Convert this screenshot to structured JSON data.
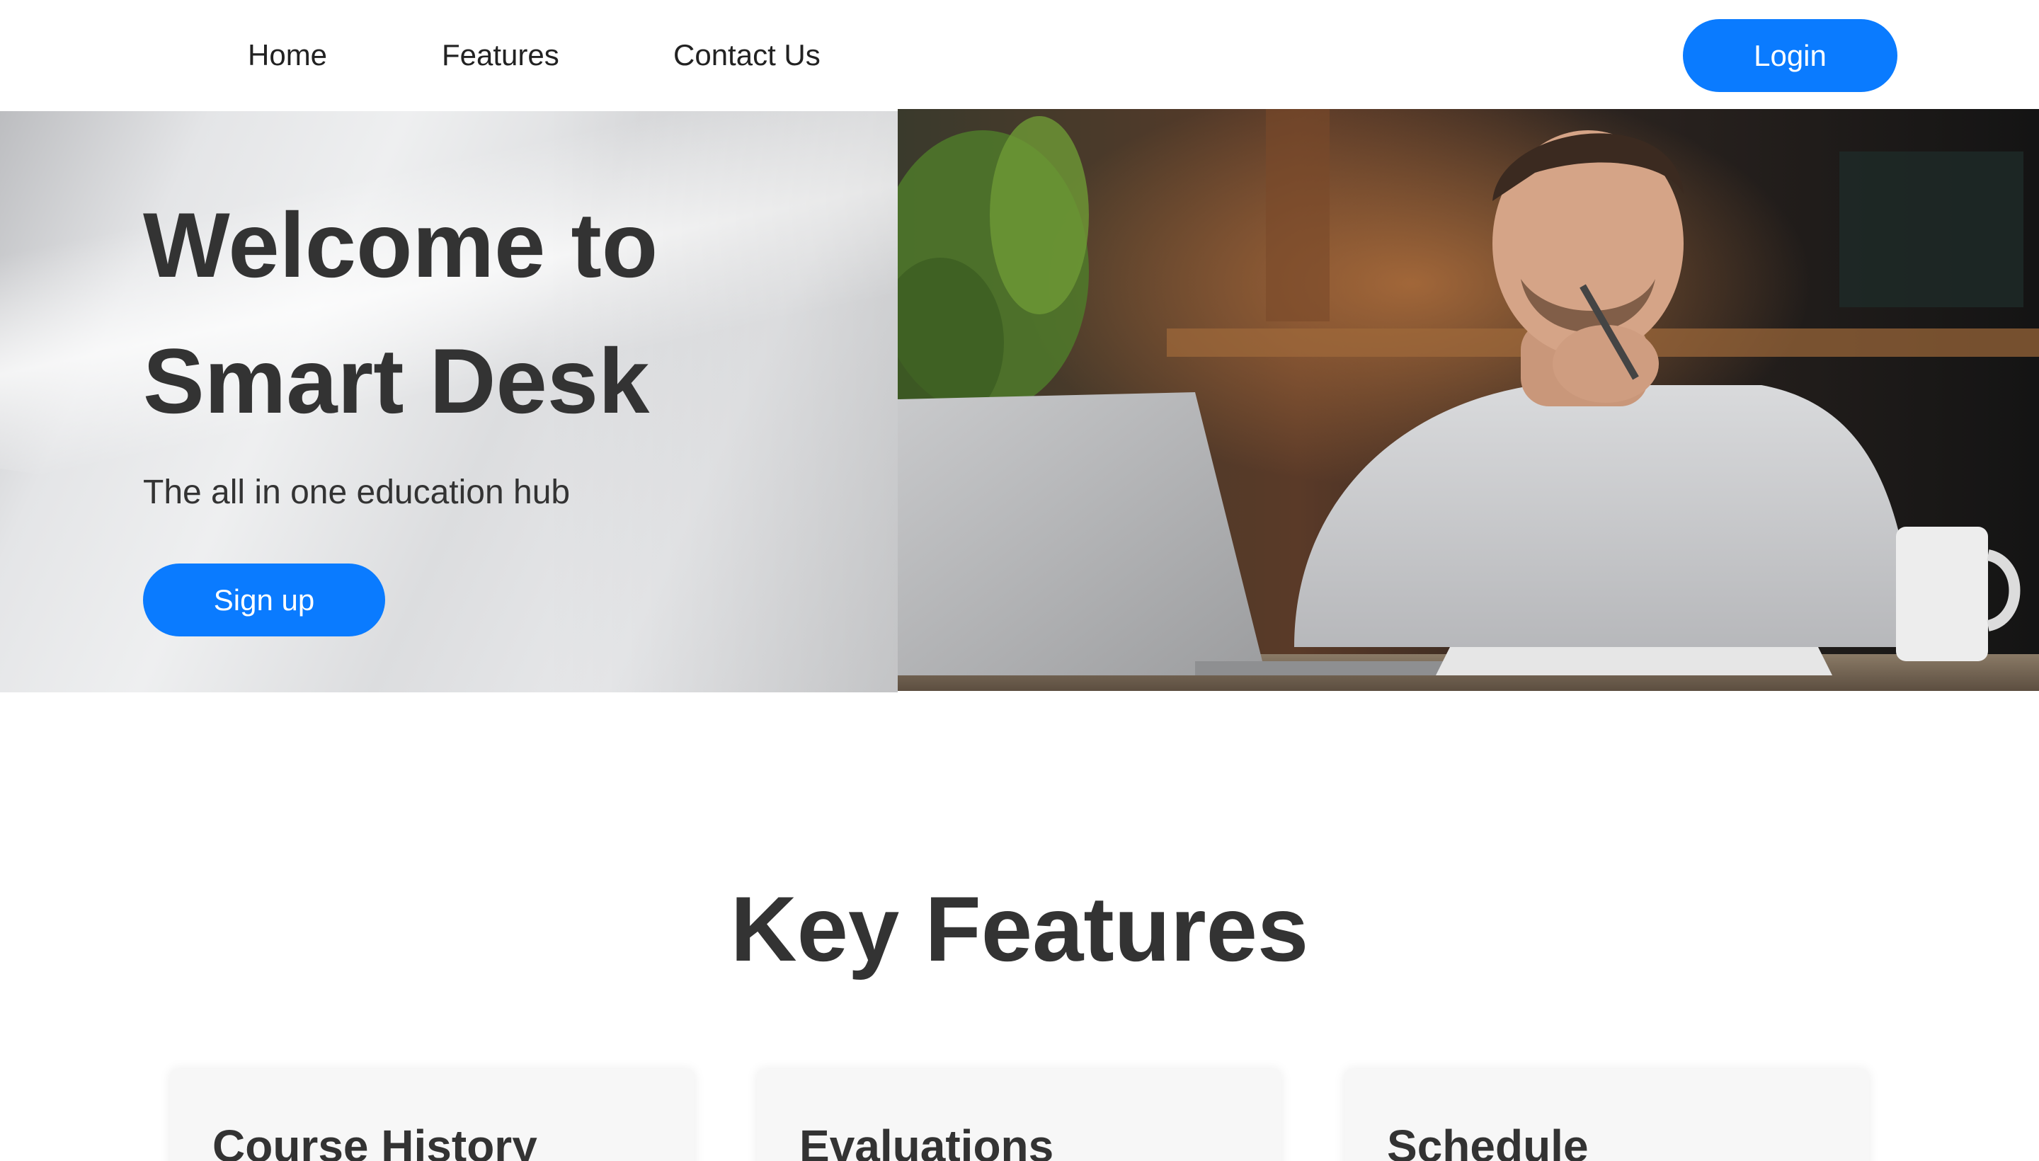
{
  "nav": {
    "links": [
      {
        "label": "Home"
      },
      {
        "label": "Features"
      },
      {
        "label": "Contact Us"
      }
    ],
    "login_label": "Login"
  },
  "hero": {
    "title": "Welcome to Smart Desk",
    "subtitle": "The all in one education hub",
    "signup_label": "Sign up",
    "image": "man-at-laptop-photo"
  },
  "features": {
    "title": "Key Features",
    "cards": [
      {
        "title": "Course History"
      },
      {
        "title": "Evaluations"
      },
      {
        "title": "Schedule"
      }
    ]
  },
  "colors": {
    "accent": "#0a7bff",
    "text": "#333333",
    "card_bg": "#f7f7f7"
  }
}
